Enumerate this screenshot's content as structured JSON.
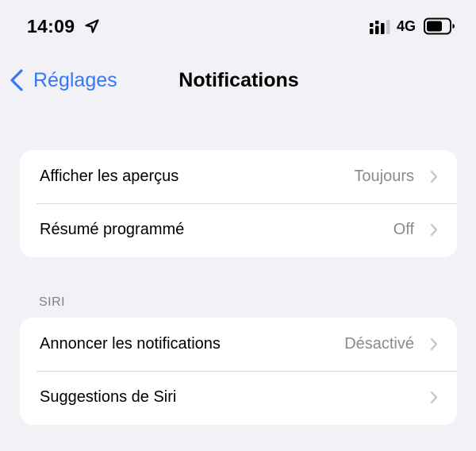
{
  "status_bar": {
    "time": "14:09",
    "network": "4G",
    "icons": [
      "location-arrow-icon",
      "signal-icon",
      "battery-icon"
    ]
  },
  "nav": {
    "back_label": "Réglages",
    "title": "Notifications",
    "accent_color": "#3478f6"
  },
  "groups": [
    {
      "header": "",
      "rows": [
        {
          "label": "Afficher les aperçus",
          "value": "Toujours"
        },
        {
          "label": "Résumé programmé",
          "value": "Off"
        }
      ]
    },
    {
      "header": "SIRI",
      "rows": [
        {
          "label": "Annoncer les notifications",
          "value": "Désactivé"
        },
        {
          "label": "Suggestions de Siri",
          "value": ""
        }
      ]
    }
  ]
}
